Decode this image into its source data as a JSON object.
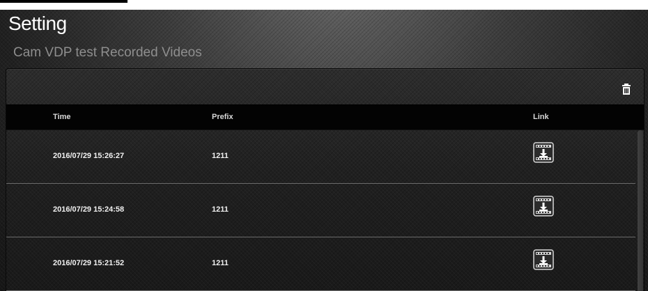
{
  "header": {
    "title": "Setting",
    "subtitle": "Cam VDP test Recorded Videos"
  },
  "toolbar": {
    "delete_icon": "trash-icon"
  },
  "table": {
    "columns": [
      "Time",
      "Prefix",
      "Link"
    ],
    "rows": [
      {
        "time": "2016/07/29 15:26:27",
        "prefix": "1211",
        "link_icon": "download-video-icon"
      },
      {
        "time": "2016/07/29 15:24:58",
        "prefix": "1211",
        "link_icon": "download-video-icon"
      },
      {
        "time": "2016/07/29 15:21:52",
        "prefix": "1211",
        "link_icon": "download-video-icon"
      }
    ]
  },
  "colors": {
    "background": "#1f1f1f",
    "panel": "#232323",
    "header_bar": "#030303",
    "text": "#ffffff",
    "muted_text": "#8e8e8e",
    "divider": "#6b6b6b"
  }
}
